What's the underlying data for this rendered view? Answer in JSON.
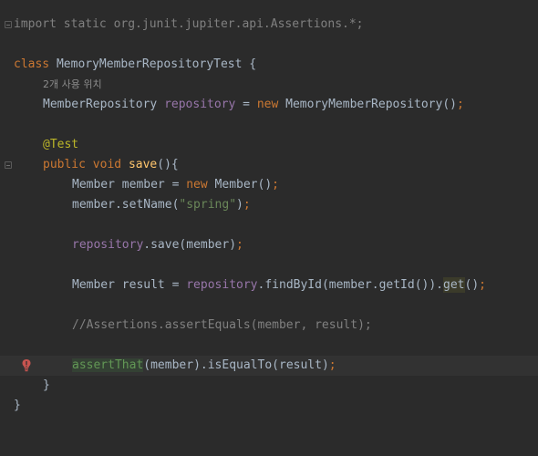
{
  "code": {
    "import_line": "import static org.junit.jupiter.api.Assertions.*;",
    "class_kw": "class",
    "class_name": "MemoryMemberRepositoryTest",
    "open_brace": " {",
    "usage_hint": "2개 사용 위치",
    "field_type": "MemberRepository",
    "field_name": "repository",
    "eq": " = ",
    "new_kw": "new",
    "field_ctor": " MemoryMemberRepository()",
    "semi": ";",
    "annotation": "@Test",
    "public_kw": "public",
    "void_kw": "void",
    "method_name": "save",
    "method_tail": "(){",
    "member_decl": "Member member = ",
    "member_ctor": " Member()",
    "set_name_call": "member.setName(",
    "spring_str": "\"spring\"",
    "close_paren": ")",
    "repo_field": "repository",
    "save_call": ".save(member)",
    "result_decl": "Member result = ",
    "find_call": ".findById(member.getId()).",
    "get_call": "get",
    "get_tail": "()",
    "comment_line": "//Assertions.assertEquals(member, result);",
    "assert_that": "assertThat",
    "assert_tail": "(member).isEqualTo(result)",
    "method_close": "}",
    "class_close": "}"
  },
  "icons": {
    "fold_marker": "fold-marker-icon",
    "error_bulb": "error-bulb-icon"
  },
  "colors": {
    "background": "#2b2b2b",
    "keyword": "#cc7832",
    "string": "#6a8759",
    "field": "#9876aa",
    "method": "#ffc66d",
    "annotation": "#bbb529",
    "comment": "#808080",
    "default_text": "#a9b7c6"
  }
}
